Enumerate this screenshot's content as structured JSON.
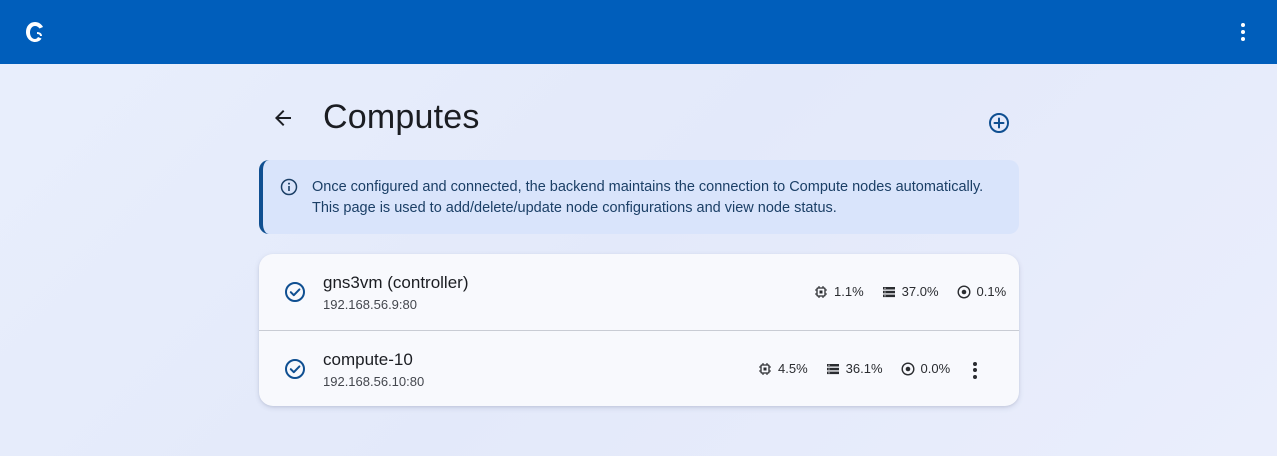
{
  "page": {
    "title": "Computes",
    "info_message": "Once configured and connected, the backend maintains the connection to Compute nodes automatically. This page is used to add/delete/update node configurations and view node status."
  },
  "icons": {
    "app_logo": "gns3-chameleon-icon",
    "menu": "more-vert-icon",
    "back": "arrow-left-icon",
    "add": "add-circle-icon",
    "info": "info-icon",
    "status_ok": "check-circle-icon",
    "cpu": "cpu-chip-icon",
    "memory": "memory-stack-icon",
    "disk": "disk-icon"
  },
  "colors": {
    "topbar": "#005ebb",
    "accent": "#0f4f91",
    "banner_bg": "#d9e4fb"
  },
  "computes": [
    {
      "name": "gns3vm (controller)",
      "address": "192.168.56.9:80",
      "cpu": "1.1%",
      "memory": "37.0%",
      "disk": "0.1%"
    },
    {
      "name": "compute-10",
      "address": "192.168.56.10:80",
      "cpu": "4.5%",
      "memory": "36.1%",
      "disk": "0.0%"
    }
  ]
}
